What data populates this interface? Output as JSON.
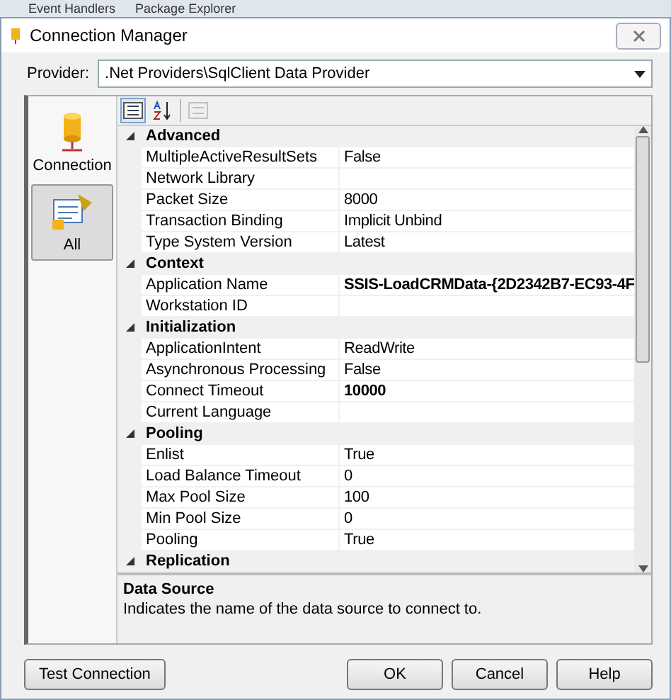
{
  "background_tabs": [
    {
      "label": "Event Handlers"
    },
    {
      "label": "Package Explorer"
    }
  ],
  "window": {
    "title": "Connection Manager"
  },
  "provider": {
    "label": "Provider:",
    "value": ".Net Providers\\SqlClient Data Provider"
  },
  "sidebar": {
    "items": [
      {
        "label": "Connection",
        "kind": "database",
        "selected": false
      },
      {
        "label": "All",
        "kind": "properties",
        "selected": true
      }
    ]
  },
  "toolbar": {
    "buttons": [
      {
        "kind": "categorized",
        "selected": true,
        "disabled": false
      },
      {
        "kind": "alphabetical",
        "selected": false,
        "disabled": false
      },
      {
        "kind": "pages",
        "selected": false,
        "disabled": true
      }
    ]
  },
  "properties": [
    {
      "category": "Advanced",
      "expanded": true,
      "rows": [
        {
          "name": "MultipleActiveResultSets",
          "value": "False",
          "modified": false
        },
        {
          "name": "Network Library"
        },
        {
          "name": "Packet Size",
          "value": "8000",
          "modified": false
        },
        {
          "name": "Transaction Binding",
          "value": "Implicit Unbind",
          "modified": false
        },
        {
          "name": "Type System Version",
          "value": "Latest",
          "modified": false
        }
      ]
    },
    {
      "category": "Context",
      "expanded": true,
      "rows": [
        {
          "name": "Application Name",
          "value": "SSIS-LoadCRMData-{2D2342B7-EC93-4F",
          "modified": true
        },
        {
          "name": "Workstation ID"
        }
      ]
    },
    {
      "category": "Initialization",
      "expanded": true,
      "rows": [
        {
          "name": "ApplicationIntent",
          "value": "ReadWrite",
          "modified": false
        },
        {
          "name": "Asynchronous Processing",
          "value": "False",
          "modified": false
        },
        {
          "name": "Connect Timeout",
          "value": "10000",
          "modified": true
        },
        {
          "name": "Current Language"
        }
      ]
    },
    {
      "category": "Pooling",
      "expanded": true,
      "rows": [
        {
          "name": "Enlist",
          "value": "True",
          "modified": false
        },
        {
          "name": "Load Balance Timeout",
          "value": "0",
          "modified": false
        },
        {
          "name": "Max Pool Size",
          "value": "100",
          "modified": false
        },
        {
          "name": "Min Pool Size",
          "value": "0",
          "modified": false
        },
        {
          "name": "Pooling",
          "value": "True",
          "modified": false
        }
      ]
    },
    {
      "category": "Replication",
      "expanded": true
    }
  ],
  "description": {
    "title": "Data Source",
    "text": "Indicates the name of the data source to connect to."
  },
  "buttons": [
    {
      "label": "Test Connection",
      "kind": "left"
    },
    {
      "label": "OK",
      "kind": "right"
    },
    {
      "label": "Cancel",
      "kind": "right"
    },
    {
      "label": "Help",
      "kind": "right"
    }
  ]
}
